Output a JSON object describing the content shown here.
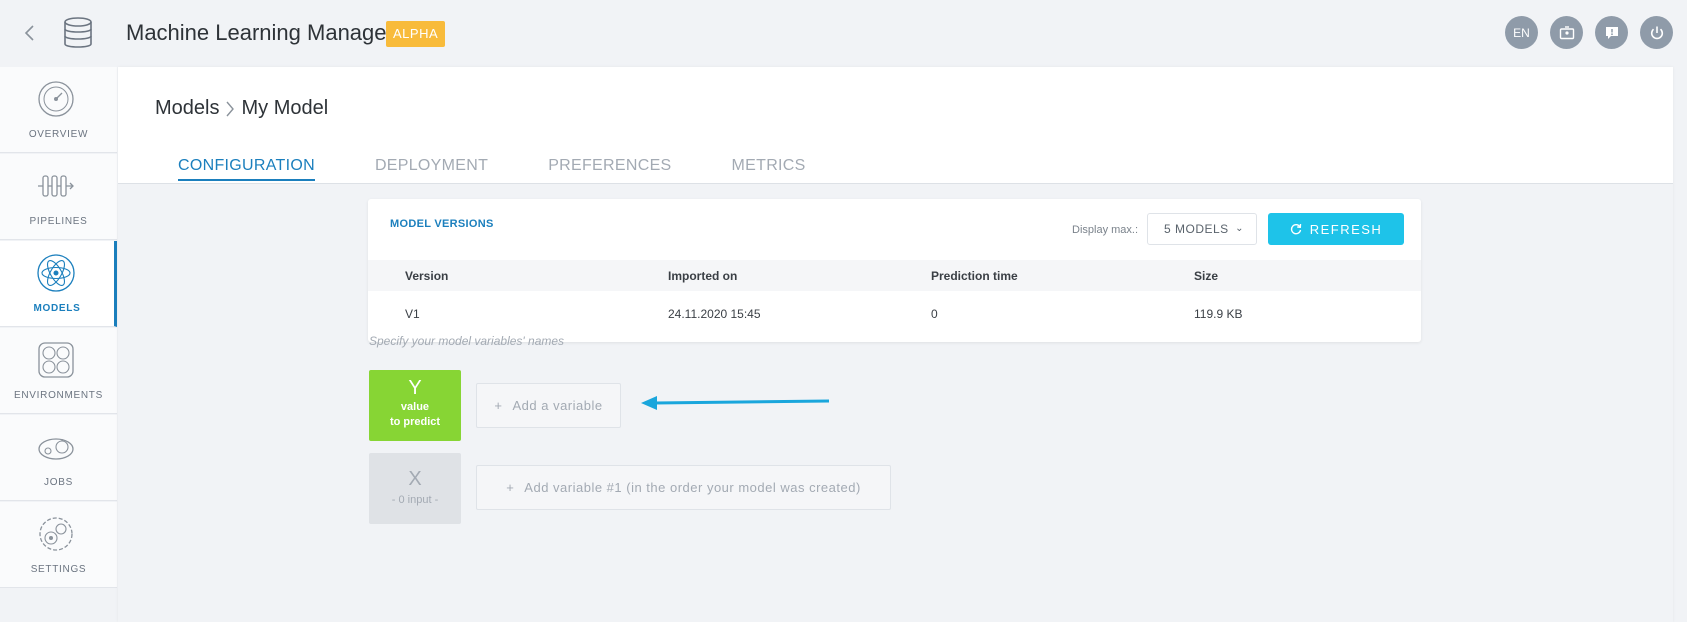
{
  "header": {
    "title": "Machine Learning Manager",
    "badge": "ALPHA",
    "lang_button": "EN"
  },
  "sidebar": {
    "items": [
      {
        "label": "OVERVIEW",
        "icon": "overview-gauge-icon",
        "active": false
      },
      {
        "label": "PIPELINES",
        "icon": "pipelines-icon",
        "active": false
      },
      {
        "label": "MODELS",
        "icon": "models-atom-icon",
        "active": true
      },
      {
        "label": "ENVIRONMENTS",
        "icon": "environments-icon",
        "active": false
      },
      {
        "label": "JOBS",
        "icon": "jobs-icon",
        "active": false
      },
      {
        "label": "SETTINGS",
        "icon": "settings-gear-icon",
        "active": false
      }
    ]
  },
  "breadcrumb": {
    "parent": "Models",
    "current": "My Model"
  },
  "tabs": [
    {
      "label": "CONFIGURATION",
      "active": true
    },
    {
      "label": "DEPLOYMENT",
      "active": false
    },
    {
      "label": "PREFERENCES",
      "active": false
    },
    {
      "label": "METRICS",
      "active": false
    }
  ],
  "versions": {
    "title": "MODEL VERSIONS",
    "display_max_label": "Display max.:",
    "display_max_value": "5 MODELS",
    "refresh_label": "REFRESH",
    "columns": [
      "Version",
      "Imported on",
      "Prediction time",
      "Size"
    ],
    "rows": [
      [
        "V1",
        "24.11.2020 15:45",
        "0",
        "119.9 KB"
      ]
    ]
  },
  "variables": {
    "hint": "Specify your model variables' names",
    "y_letter": "Y",
    "y_sub_1": "value",
    "y_sub_2": "to predict",
    "add_y_label": "Add a variable",
    "x_letter": "X",
    "x_sub": "- 0 input -",
    "add_x_label": "Add variable #1 (in the order your model was created)"
  },
  "colors": {
    "accent": "#1b7fbd",
    "refresh": "#1ec3e9",
    "y_block": "#87d534",
    "badge": "#f8bb3b",
    "arrow": "#1aa6dc"
  }
}
